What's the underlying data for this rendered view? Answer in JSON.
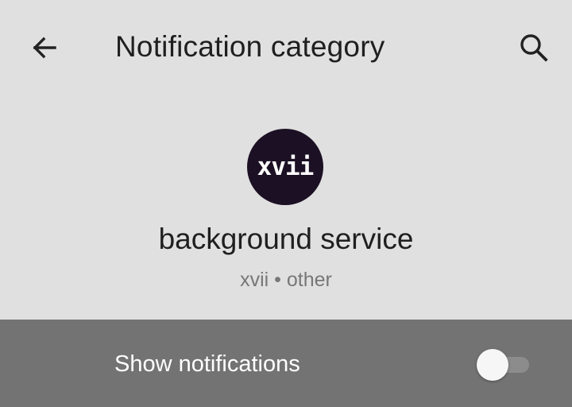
{
  "header": {
    "title": "Notification category",
    "back_icon": "arrow-back-icon",
    "search_icon": "search-icon"
  },
  "app": {
    "icon_text": "xvii",
    "icon_color": "#1c1024",
    "channel_name": "background service",
    "subtitle": "xvii • other"
  },
  "switch_bar": {
    "label": "Show notifications",
    "enabled": false,
    "background": "#737373"
  }
}
